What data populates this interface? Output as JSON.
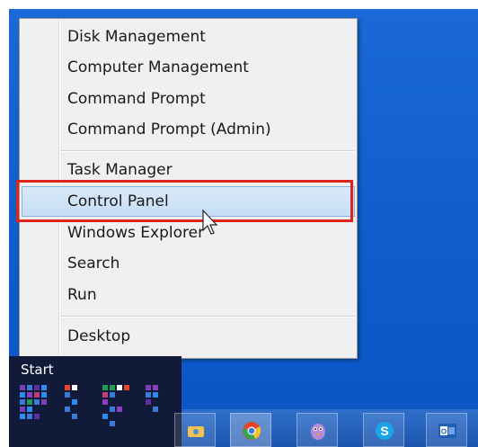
{
  "menu": {
    "groups": [
      [
        "Disk Management",
        "Computer Management",
        "Command Prompt",
        "Command Prompt (Admin)"
      ],
      [
        "Task Manager",
        "Control Panel",
        "Windows Explorer",
        "Search",
        "Run"
      ],
      [
        "Desktop"
      ]
    ],
    "highlighted_item": "Control Panel"
  },
  "items": {
    "disk_management": "Disk Management",
    "computer_management": "Computer Management",
    "command_prompt": "Command Prompt",
    "command_prompt_admin": "Command Prompt (Admin)",
    "task_manager": "Task Manager",
    "control_panel": "Control Panel",
    "windows_explorer": "Windows Explorer",
    "search": "Search",
    "run": "Run",
    "desktop": "Desktop"
  },
  "start": {
    "label": "Start"
  },
  "taskbar": {
    "buttons": [
      "file-explorer-icon",
      "chrome-icon",
      "pidgin-icon",
      "skype-icon",
      "outlook-icon"
    ],
    "active_button": "chrome-icon"
  },
  "colors": {
    "highlight_border": "#e0231a",
    "hover_fill": "#c6def6",
    "desktop_blue": "#1b6ad8",
    "start_bg": "#121a3a"
  }
}
